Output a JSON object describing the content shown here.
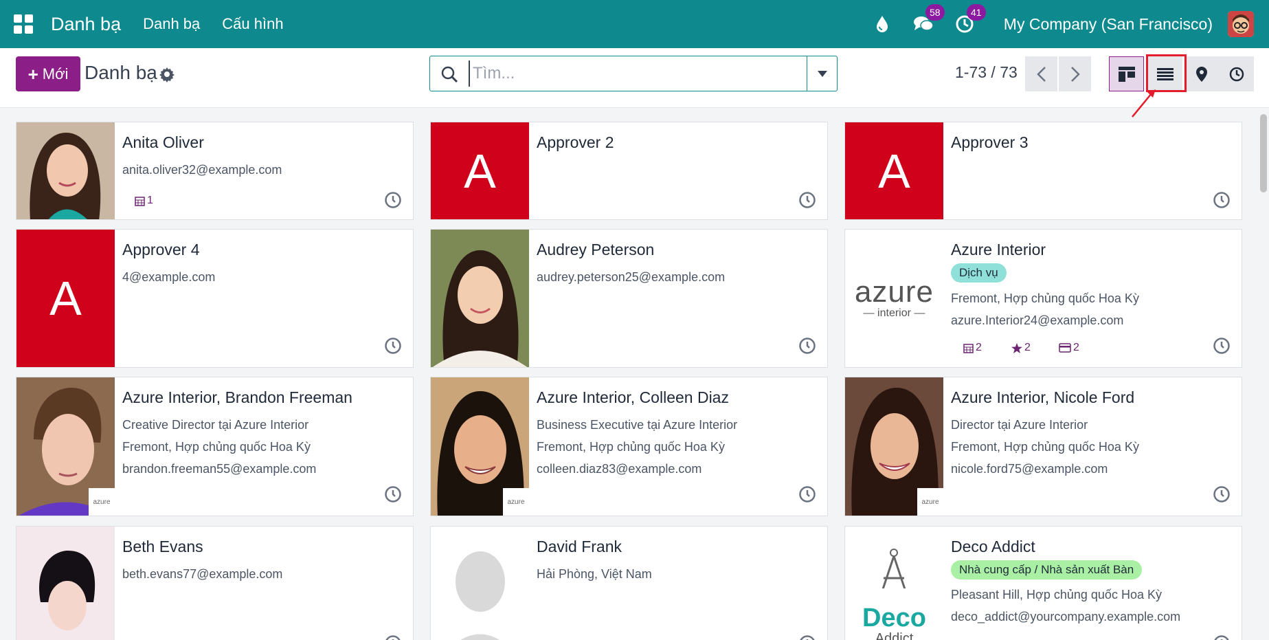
{
  "navbar": {
    "brand": "Danh bạ",
    "menu": [
      "Danh bạ",
      "Cấu hình"
    ],
    "messages_badge": "58",
    "activities_badge": "41",
    "company": "My Company (San Francisco)"
  },
  "control_panel": {
    "new_button": "Mới",
    "title": "Danh bạ",
    "search_placeholder": "Tìm...",
    "pager": "1-73 / 73"
  },
  "cards": [
    {
      "name": "Anita Oliver",
      "email": "anita.oliver32@example.com",
      "counters": [
        "1"
      ]
    },
    {
      "name": "Approver 2",
      "letter": "A"
    },
    {
      "name": "Approver 3",
      "letter": "A"
    },
    {
      "name": "Approver 4",
      "letter": "A",
      "email": "4@example.com"
    },
    {
      "name": "Audrey Peterson",
      "email": "audrey.peterson25@example.com"
    },
    {
      "name": "Azure Interior",
      "tag": "Dịch vụ",
      "location": "Fremont, Hợp chủng quốc Hoa Kỳ",
      "email": "azure.Interior24@example.com",
      "counters": [
        "2",
        "2",
        "2"
      ],
      "logo_text": "azure",
      "logo_sub": "— interior —"
    },
    {
      "name": "Azure Interior, Brandon Freeman",
      "job": "Creative Director tại Azure Interior",
      "location": "Fremont, Hợp chủng quốc Hoa Kỳ",
      "email": "brandon.freeman55@example.com",
      "thumb": "azure"
    },
    {
      "name": "Azure Interior, Colleen Diaz",
      "job": "Business Executive tại Azure Interior",
      "location": "Fremont, Hợp chủng quốc Hoa Kỳ",
      "email": "colleen.diaz83@example.com",
      "thumb": "azure"
    },
    {
      "name": "Azure Interior, Nicole Ford",
      "job": "Director tại Azure Interior",
      "location": "Fremont, Hợp chủng quốc Hoa Kỳ",
      "email": "nicole.ford75@example.com",
      "thumb": "azure"
    },
    {
      "name": "Beth Evans",
      "email": "beth.evans77@example.com"
    },
    {
      "name": "David Frank",
      "location": "Hải Phòng, Việt Nam"
    },
    {
      "name": "Deco Addict",
      "tag": "Nhà cung cấp / Nhà sản xuất Bàn",
      "location": "Pleasant Hill, Hợp chủng quốc Hoa Kỳ",
      "email": "deco_addict@yourcompany.example.com",
      "logo_text": "Deco",
      "logo_sub": "Addict"
    }
  ],
  "colors": {
    "navbar": "#0e8a8f",
    "primary": "#8b1f87",
    "letter_avatar": "#d0021b"
  }
}
